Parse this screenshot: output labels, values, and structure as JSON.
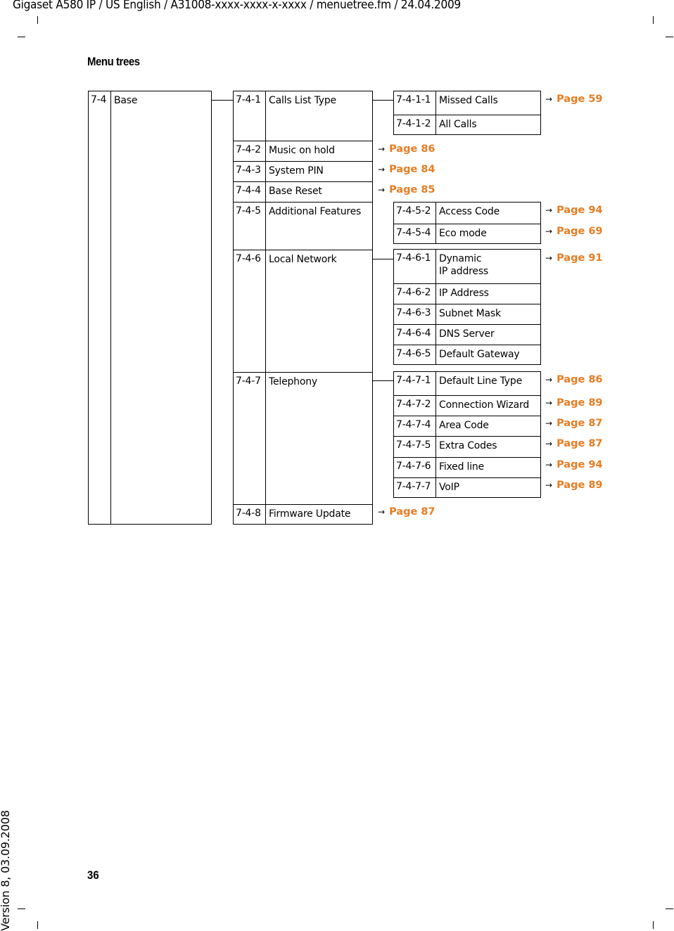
{
  "header": {
    "running_head": "Gigaset A580 IP / US English / A31008-xxxx-xxxx-x-xxxx / menuetree.fm / 24.04.2009",
    "section_title": "Menu trees",
    "page_number": "36",
    "version_margin": "Version 8, 03.09.2008"
  },
  "colors": {
    "page_ref": "#e87c22",
    "text": "#000000"
  },
  "icons": {
    "arrow": "→"
  },
  "menu": {
    "root": {
      "code": "7-4",
      "label": "Base"
    },
    "level2": [
      {
        "code": "7-4-1",
        "label": "Calls List Type"
      },
      {
        "code": "7-4-2",
        "label": "Music on hold",
        "ref": "Page 86"
      },
      {
        "code": "7-4-3",
        "label": "System PIN",
        "ref": "Page 84"
      },
      {
        "code": "7-4-4",
        "label": "Base Reset",
        "ref": "Page 85"
      },
      {
        "code": "7-4-5",
        "label": "Additional Features"
      },
      {
        "code": "7-4-6",
        "label": "Local Network"
      },
      {
        "code": "7-4-7",
        "label": "Telephony"
      },
      {
        "code": "7-4-8",
        "label": "Firmware Update",
        "ref": "Page 87"
      }
    ],
    "calls_list_type": [
      {
        "code": "7-4-1-1",
        "label": "Missed Calls"
      },
      {
        "code": "7-4-1-2",
        "label": "All Calls"
      }
    ],
    "calls_list_type_ref": "Page 59",
    "additional_features": [
      {
        "code": "7-4-5-2",
        "label": "Access Code",
        "ref": "Page 94"
      },
      {
        "code": "7-4-5-4",
        "label": "Eco mode",
        "ref": "Page 69"
      }
    ],
    "local_network": [
      {
        "code": "7-4-6-1",
        "label_line1": "Dynamic",
        "label_line2": "IP address"
      },
      {
        "code": "7-4-6-2",
        "label": "IP Address"
      },
      {
        "code": "7-4-6-3",
        "label": "Subnet Mask"
      },
      {
        "code": "7-4-6-4",
        "label": "DNS Server"
      },
      {
        "code": "7-4-6-5",
        "label": "Default Gateway"
      }
    ],
    "local_network_ref": "Page 91",
    "telephony": [
      {
        "code": "7-4-7-1",
        "label": "Default Line Type",
        "ref": "Page 86"
      },
      {
        "code": "7-4-7-2",
        "label": "Connection Wizard",
        "ref": "Page 89"
      },
      {
        "code": "7-4-7-4",
        "label": "Area Code",
        "ref": "Page 87"
      },
      {
        "code": "7-4-7-5",
        "label": "Extra Codes",
        "ref": "Page 87"
      },
      {
        "code": "7-4-7-6",
        "label": "Fixed line",
        "ref": "Page 94"
      },
      {
        "code": "7-4-7-7",
        "label": "VoIP",
        "ref": "Page 89"
      }
    ]
  }
}
